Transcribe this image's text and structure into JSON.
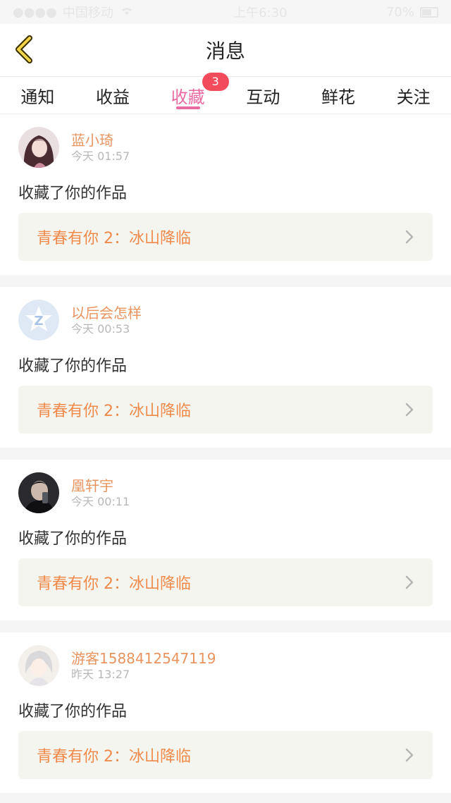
{
  "status_bar": {
    "carrier": "中国移动",
    "time": "上午6:30",
    "battery": "70%"
  },
  "nav": {
    "title": "消息",
    "back_icon": "chevron-left-icon"
  },
  "tabs": [
    {
      "label": "通知"
    },
    {
      "label": "收益"
    },
    {
      "label": "收藏",
      "badge": "3"
    },
    {
      "label": "互动"
    },
    {
      "label": "鲜花"
    },
    {
      "label": "关注"
    }
  ],
  "messages": [
    {
      "username": "蓝小琦",
      "time": "今天 01:57",
      "action": "收藏了你的作品",
      "work": "青春有你 2：冰山降临",
      "avatar": "avatar-girl-dark-hair"
    },
    {
      "username": "以后会怎样",
      "time": "今天 00:53",
      "action": "收藏了你的作品",
      "work": "青春有你 2：冰山降临",
      "avatar": "avatar-default-q"
    },
    {
      "username": "凰轩宇",
      "time": "今天 00:11",
      "action": "收藏了你的作品",
      "work": "青春有你 2：冰山降临",
      "avatar": "avatar-boy-dark"
    },
    {
      "username": "游客1588412547119",
      "time": "昨天 13:27",
      "action": "收藏了你的作品",
      "work": "青春有你 2：冰山降临",
      "avatar": "avatar-anime-white-hair"
    }
  ],
  "colors": {
    "accent": "#e86aa1",
    "username": "#e9945f",
    "work": "#f08a4b",
    "badge": "#f24b5b"
  }
}
